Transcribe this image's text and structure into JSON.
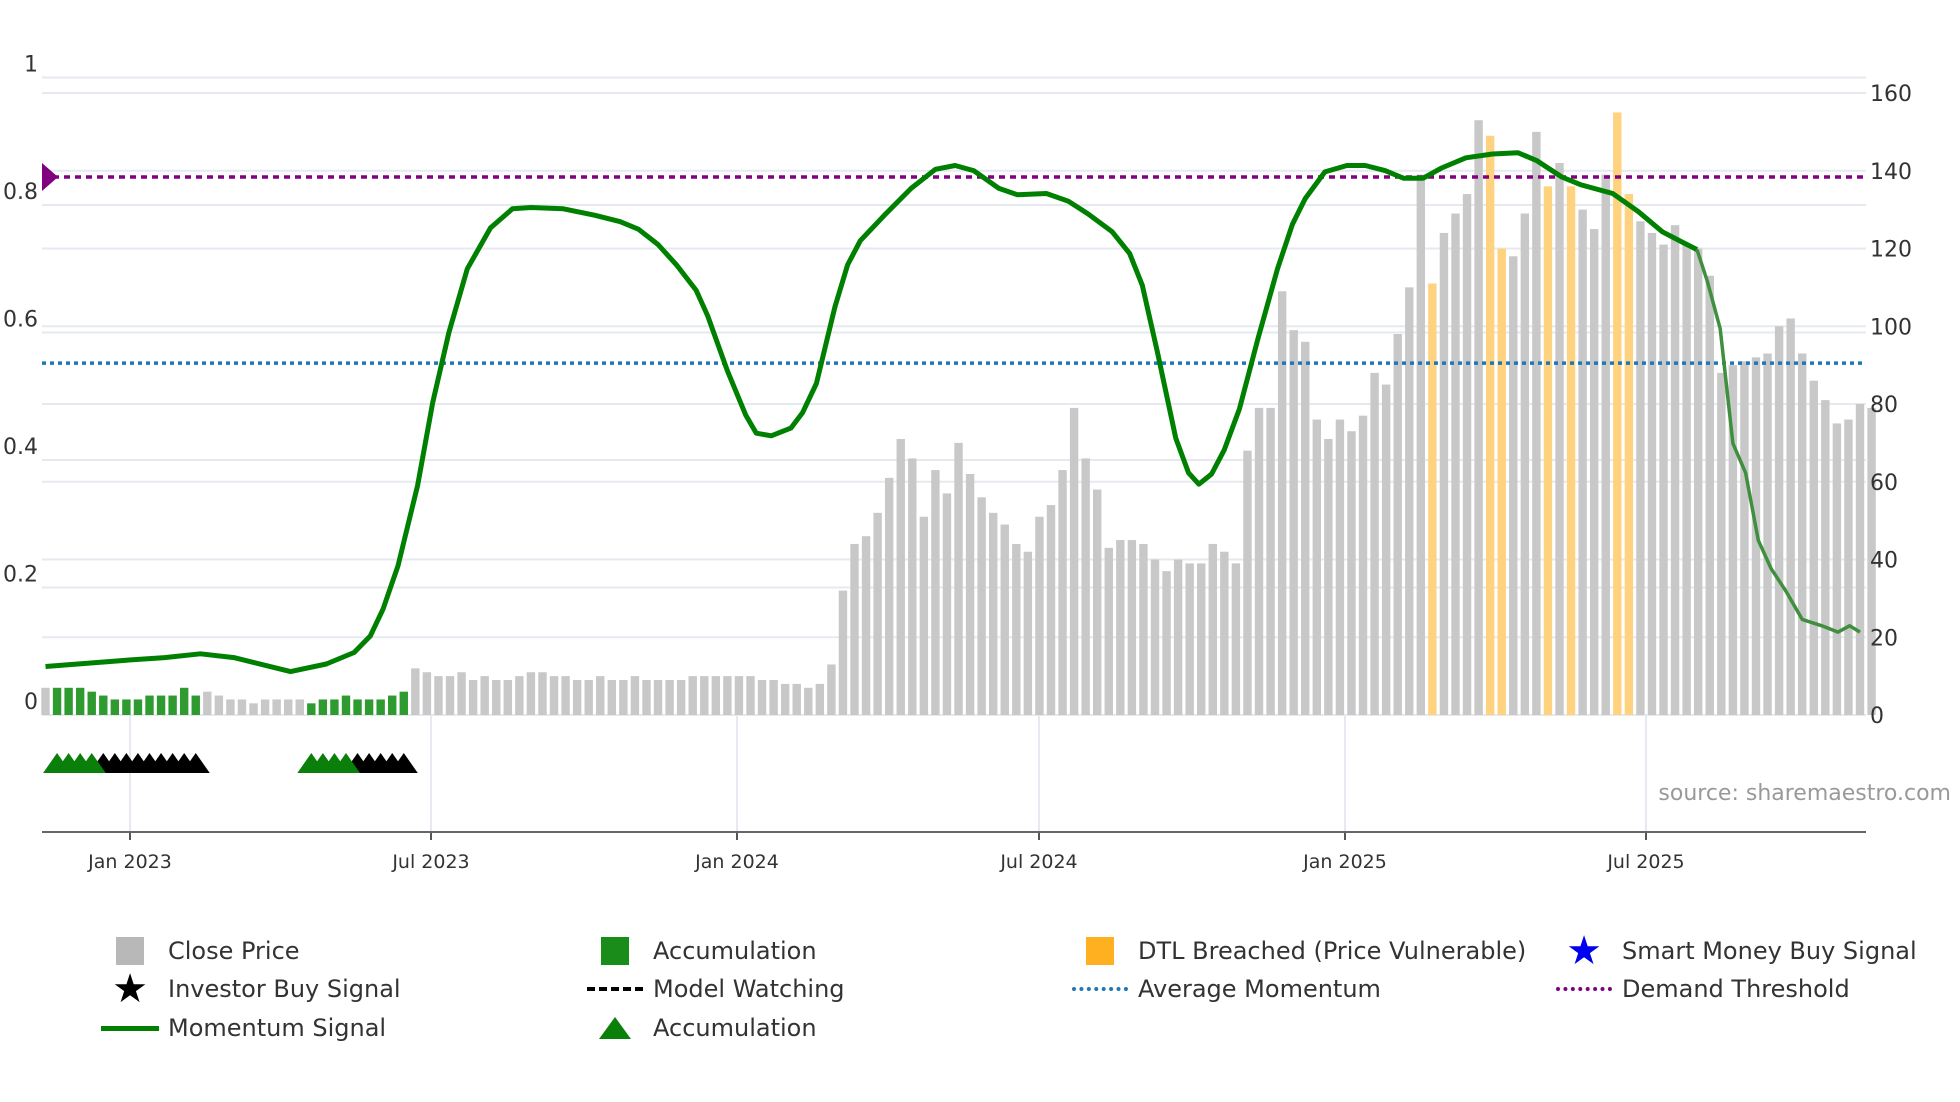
{
  "chart_data": {
    "type": "bar",
    "title": "",
    "x_unit": "week index (weekly bars)",
    "x_ticks": [
      "Jan 2023",
      "Jul 2023",
      "Jan 2024",
      "Jul 2024",
      "Jan 2025",
      "Jul 2025"
    ],
    "left_axis": {
      "ticks": [
        "0",
        "0.2",
        "0.4",
        "0.6",
        "0.8",
        "1"
      ],
      "range": [
        0,
        1
      ]
    },
    "right_axis": {
      "ticks": [
        "0",
        "20",
        "40",
        "60",
        "80",
        "100",
        "120",
        "140",
        "160"
      ],
      "range": [
        0,
        160
      ]
    },
    "close_price": [
      7,
      7,
      7,
      7,
      6,
      5,
      4,
      4,
      4,
      5,
      5,
      5,
      7,
      5,
      6,
      5,
      4,
      4,
      3,
      4,
      4,
      4,
      4,
      3,
      4,
      4,
      5,
      4,
      4,
      4,
      5,
      6,
      12,
      11,
      10,
      10,
      11,
      9,
      10,
      9,
      9,
      10,
      11,
      11,
      10,
      10,
      9,
      9,
      10,
      9,
      9,
      10,
      9,
      9,
      9,
      9,
      10,
      10,
      10,
      10,
      10,
      10,
      9,
      9,
      8,
      8,
      7,
      8,
      13,
      32,
      44,
      46,
      52,
      61,
      71,
      66,
      51,
      63,
      57,
      70,
      62,
      56,
      52,
      49,
      44,
      42,
      51,
      54,
      63,
      79,
      66,
      58,
      43,
      45,
      45,
      44,
      40,
      37,
      40,
      39,
      39,
      44,
      42,
      39,
      68,
      79,
      79,
      109,
      99,
      96,
      76,
      71,
      76,
      73,
      77,
      88,
      85,
      98,
      110,
      139,
      111,
      124,
      129,
      134,
      153,
      149,
      120,
      118,
      129,
      150,
      136,
      142,
      136,
      130,
      125,
      139,
      155,
      134,
      127,
      124,
      121,
      126,
      121,
      120,
      113,
      88,
      90,
      91,
      92,
      93,
      100,
      102,
      93,
      86,
      81,
      75,
      76,
      80,
      79
    ],
    "accumulation_bar_indices": [
      1,
      2,
      3,
      4,
      5,
      6,
      7,
      8,
      9,
      10,
      11,
      12,
      13,
      23,
      24,
      25,
      26,
      27,
      28,
      29,
      30,
      31
    ],
    "dtl_breached_bar_indices": [
      120,
      125,
      126,
      130,
      132,
      136,
      137
    ],
    "accumulation_signal_indices": [
      1,
      2,
      3,
      4,
      23,
      24,
      25,
      26
    ],
    "model_watching_signal_indices": [
      5,
      6,
      7,
      8,
      9,
      10,
      11,
      12,
      13,
      27,
      28,
      29,
      30,
      31
    ],
    "momentum_signal": [
      [
        0,
        0.076
      ],
      [
        7,
        0.086
      ],
      [
        10.3,
        0.09
      ],
      [
        13.4,
        0.096
      ],
      [
        16.3,
        0.09
      ],
      [
        21.2,
        0.068
      ],
      [
        24.3,
        0.08
      ],
      [
        26.7,
        0.098
      ],
      [
        28.1,
        0.124
      ],
      [
        29.2,
        0.166
      ],
      [
        30.5,
        0.234
      ],
      [
        32.2,
        0.36
      ],
      [
        33.5,
        0.49
      ],
      [
        34.9,
        0.6
      ],
      [
        36.5,
        0.7
      ],
      [
        38.5,
        0.764
      ],
      [
        40.4,
        0.794
      ],
      [
        42,
        0.796
      ],
      [
        44.8,
        0.794
      ],
      [
        47.5,
        0.784
      ],
      [
        49.7,
        0.774
      ],
      [
        51.3,
        0.762
      ],
      [
        53,
        0.738
      ],
      [
        54.6,
        0.706
      ],
      [
        56.3,
        0.666
      ],
      [
        57.3,
        0.626
      ],
      [
        59,
        0.54
      ],
      [
        60.6,
        0.47
      ],
      [
        61.5,
        0.442
      ],
      [
        62.8,
        0.438
      ],
      [
        64.5,
        0.45
      ],
      [
        65.5,
        0.474
      ],
      [
        66.7,
        0.52
      ],
      [
        68.3,
        0.64
      ],
      [
        69.4,
        0.706
      ],
      [
        70.5,
        0.744
      ],
      [
        72.7,
        0.786
      ],
      [
        74.9,
        0.826
      ],
      [
        77,
        0.856
      ],
      [
        78.7,
        0.862
      ],
      [
        80.3,
        0.854
      ],
      [
        82.5,
        0.826
      ],
      [
        84.1,
        0.816
      ],
      [
        86.6,
        0.818
      ],
      [
        88.5,
        0.806
      ],
      [
        90.2,
        0.786
      ],
      [
        92.3,
        0.758
      ],
      [
        93.8,
        0.724
      ],
      [
        94.9,
        0.674
      ],
      [
        96.2,
        0.57
      ],
      [
        97.8,
        0.434
      ],
      [
        98.9,
        0.38
      ],
      [
        99.8,
        0.362
      ],
      [
        100.9,
        0.378
      ],
      [
        102,
        0.416
      ],
      [
        103.3,
        0.48
      ],
      [
        104.9,
        0.59
      ],
      [
        106.6,
        0.7
      ],
      [
        107.9,
        0.77
      ],
      [
        109,
        0.81
      ],
      [
        110.7,
        0.852
      ],
      [
        112.6,
        0.862
      ],
      [
        114.2,
        0.862
      ],
      [
        115.9,
        0.854
      ],
      [
        117.5,
        0.842
      ],
      [
        119.2,
        0.842
      ],
      [
        120.8,
        0.858
      ],
      [
        122.9,
        0.874
      ],
      [
        125.2,
        0.88
      ],
      [
        127.4,
        0.882
      ],
      [
        129,
        0.87
      ],
      [
        131.2,
        0.844
      ],
      [
        132.8,
        0.832
      ],
      [
        135.6,
        0.818
      ],
      [
        137.8,
        0.79
      ],
      [
        139.9,
        0.758
      ],
      [
        141.6,
        0.742
      ],
      [
        142.9,
        0.73
      ]
    ],
    "momentum_signal_recent": [
      [
        142.9,
        0.73
      ],
      [
        143.8,
        0.68
      ],
      [
        144.9,
        0.606
      ],
      [
        146,
        0.426
      ],
      [
        147.1,
        0.38
      ],
      [
        148.2,
        0.274
      ],
      [
        149.3,
        0.23
      ],
      [
        150.6,
        0.194
      ],
      [
        152,
        0.15
      ],
      [
        153.7,
        0.14
      ],
      [
        155.1,
        0.13
      ],
      [
        156.1,
        0.14
      ],
      [
        157,
        0.13
      ]
    ],
    "average_momentum": 0.552,
    "demand_threshold": 0.844,
    "source": "source: sharemaestro.com",
    "legend": [
      {
        "label": "Close Price",
        "icon": "gray-square"
      },
      {
        "label": "Investor Buy Signal",
        "icon": "black-star"
      },
      {
        "label": "Momentum Signal",
        "icon": "green-line"
      },
      {
        "label": "Accumulation",
        "icon": "green-square"
      },
      {
        "label": "Model Watching",
        "icon": "black-dashed-line"
      },
      {
        "label": "Accumulation",
        "icon": "green-triangle"
      },
      {
        "label": "DTL Breached (Price Vulnerable)",
        "icon": "orange-square"
      },
      {
        "label": "Average Momentum",
        "icon": "blue-dotted-line"
      },
      {
        "label": "Smart Money Buy Signal",
        "icon": "blue-star"
      },
      {
        "label": "Demand Threshold",
        "icon": "purple-dotted-line"
      }
    ],
    "colors": {
      "price": "#c8c8c8",
      "accumulation": "#2f9a2f",
      "dtl": "#ffd27f",
      "momentum": "#008000",
      "momentum_recent": "#3f8f3f",
      "avg": "#1f77b4",
      "threshold": "#800080",
      "grid": "#e6eaf0"
    }
  }
}
